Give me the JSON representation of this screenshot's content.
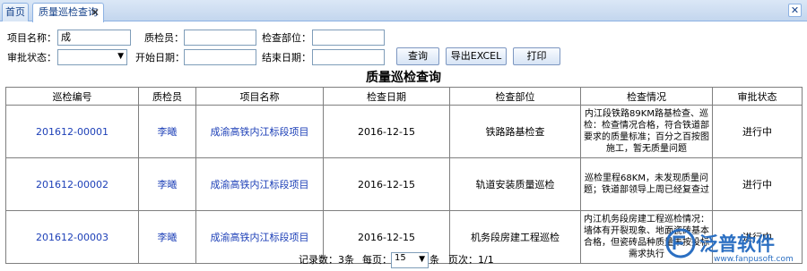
{
  "tabs": {
    "home": "首页",
    "active": "质量巡检查询",
    "tab_close": "✕",
    "window_close": "✕"
  },
  "form": {
    "project_name_label": "项目名称：",
    "project_name_value": "成",
    "inspector_label": "质检员：",
    "inspector_value": "",
    "dept_label": "检查部位：",
    "dept_value": "",
    "approval_label": "审批状态：",
    "approval_value": "",
    "start_label": "开始日期：",
    "start_value": "",
    "end_label": "结束日期：",
    "end_value": "",
    "query_btn": "查询",
    "export_btn": "导出EXCEL",
    "print_btn": "打印"
  },
  "report_title": "质量巡检查询",
  "table": {
    "headers": [
      "巡检编号",
      "质检员",
      "项目名称",
      "检查日期",
      "检查部位",
      "检查情况",
      "审批状态"
    ],
    "rows": [
      {
        "code": "201612-00001",
        "inspector": "李曦",
        "project": "成渝高铁内江标段项目",
        "date": "2016-12-15",
        "part": "铁路路基检查",
        "detail": "内江段铁路89KM路基检查、巡检：检查情况合格，符合铁道部要求的质量标准；百分之百按图施工，暂无质量问题",
        "status": "进行中"
      },
      {
        "code": "201612-00002",
        "inspector": "李曦",
        "project": "成渝高铁内江标段项目",
        "date": "2016-12-15",
        "part": "轨道安装质量巡检",
        "detail": "巡检里程68KM，未发现质量问题；铁道部领导上周已经复查过",
        "status": "进行中"
      },
      {
        "code": "201612-00003",
        "inspector": "李曦",
        "project": "成渝高铁内江标段项目",
        "date": "2016-12-15",
        "part": "机务段房建工程巡检",
        "detail": "内江机务段房建工程巡检情况：墙体有开裂现象、地面瓷砖基本合格，但瓷砖品种质量未按投标需求执行",
        "status": "进行中"
      }
    ]
  },
  "footer": {
    "records": "记录数：3条",
    "per_page_label": "每页：",
    "per_page_value": "15",
    "per_page_unit": "条",
    "pages": "页次：1/1"
  },
  "watermark": {
    "brand": "泛普软件",
    "url": "www.fanpusoft.com"
  }
}
